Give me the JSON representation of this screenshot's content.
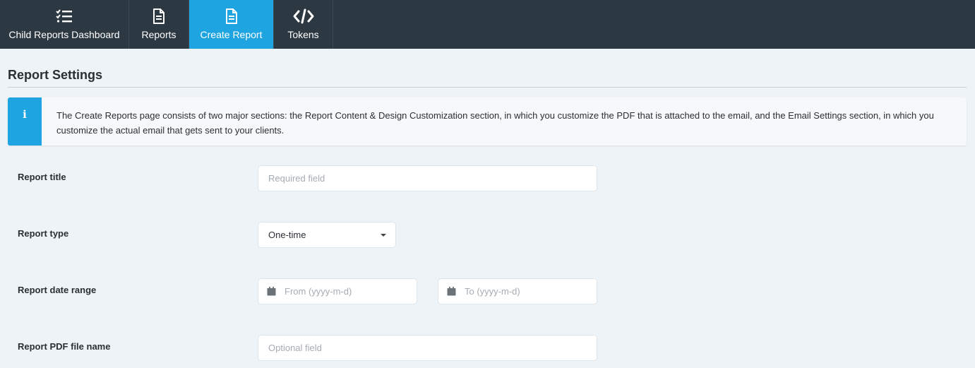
{
  "nav": {
    "tabs": [
      {
        "label": "Child Reports Dashboard",
        "icon": "tasks-list-icon",
        "active": false
      },
      {
        "label": "Reports",
        "icon": "document-icon",
        "active": false
      },
      {
        "label": "Create Report",
        "icon": "document-icon",
        "active": true
      },
      {
        "label": "Tokens",
        "icon": "code-icon",
        "active": false
      }
    ]
  },
  "section": {
    "title": "Report Settings"
  },
  "info": {
    "icon": "info-icon",
    "text": "The Create Reports page consists of two major sections: the Report Content & Design Customization section, in which you customize the PDF that is attached to the email, and the Email Settings section, in which you customize the actual email that gets sent to your clients."
  },
  "form": {
    "report_title": {
      "label": "Report title",
      "placeholder": "Required field",
      "value": ""
    },
    "report_type": {
      "label": "Report type",
      "selected": "One-time"
    },
    "date_range": {
      "label": "Report date range",
      "from_placeholder": "From (yyyy-m-d)",
      "to_placeholder": "To (yyyy-m-d)"
    },
    "pdf_file_name": {
      "label": "Report PDF file name",
      "placeholder": "Optional field",
      "value": ""
    }
  },
  "colors": {
    "nav_bg": "#2c3943",
    "accent": "#1ea4e0",
    "page_bg": "#eef3f7"
  }
}
